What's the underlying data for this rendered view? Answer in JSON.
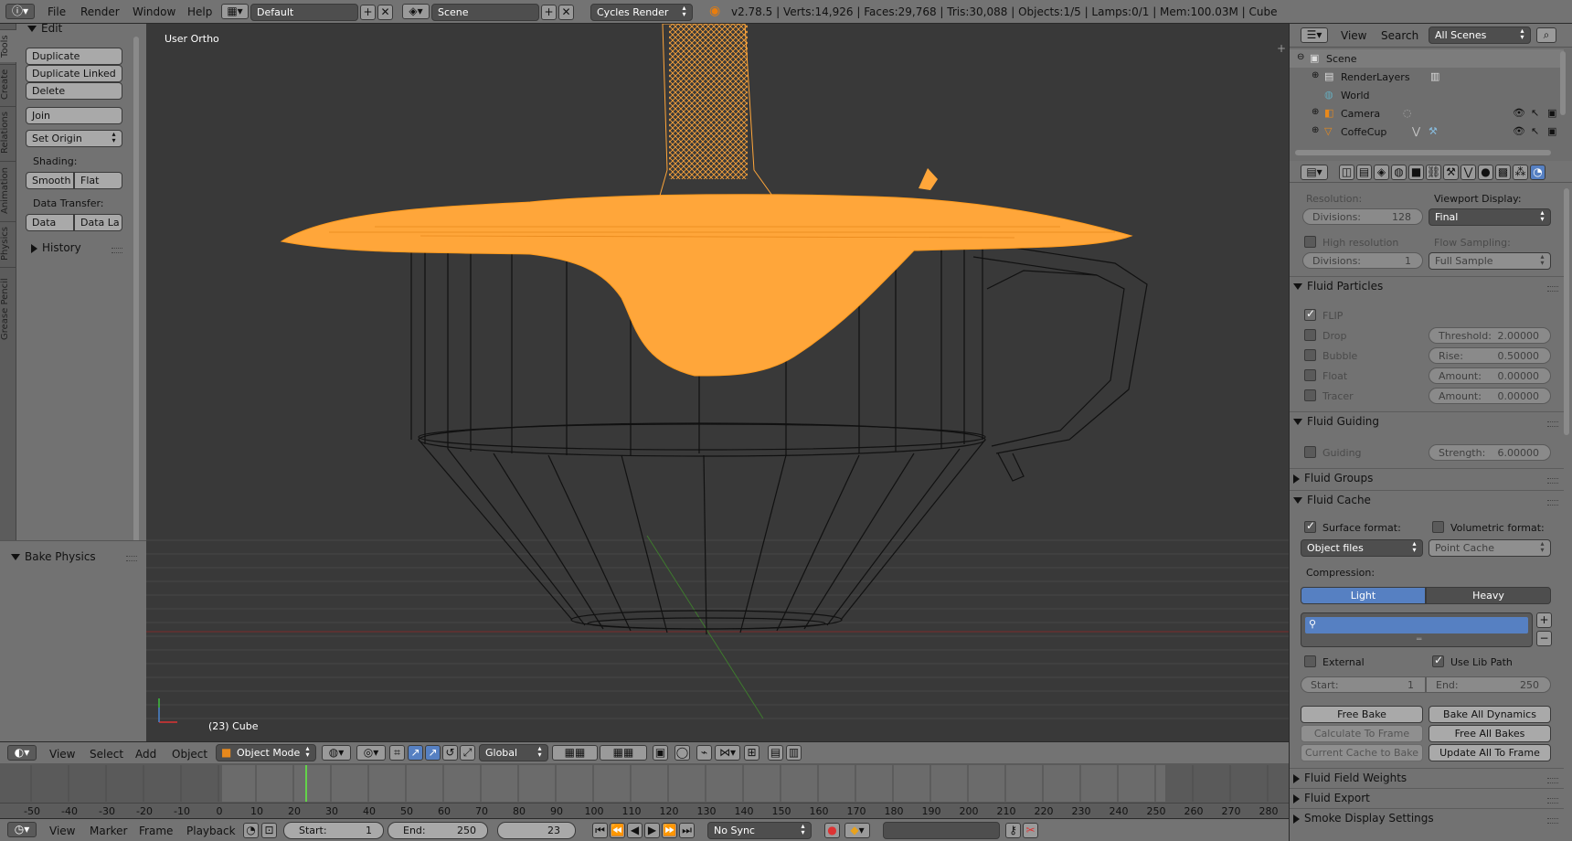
{
  "topbar": {
    "menus": [
      "File",
      "Render",
      "Window",
      "Help"
    ],
    "layout": "Default",
    "scene": "Scene",
    "engine": "Cycles Render",
    "stats": "v2.78.5 | Verts:14,926 | Faces:29,768 | Tris:30,088 | Objects:1/5 | Lamps:0/1 | Mem:100.03M | Cube"
  },
  "tools": {
    "tabs": [
      "Tools",
      "Create",
      "Relations",
      "Animation",
      "Physics",
      "Grease Pencil"
    ],
    "edit_header": "Edit",
    "duplicate": "Duplicate",
    "duplicate_linked": "Duplicate Linked",
    "delete": "Delete",
    "join": "Join",
    "set_origin": "Set Origin",
    "shading_label": "Shading:",
    "smooth": "Smooth",
    "flat": "Flat",
    "data_transfer_label": "Data Transfer:",
    "data": "Data",
    "data_layout": "Data La",
    "history": "History",
    "bake_physics": "Bake Physics"
  },
  "viewport": {
    "view_name": "User Ortho",
    "object_info": "(23) Cube",
    "header": {
      "view": "View",
      "select": "Select",
      "add": "Add",
      "object": "Object",
      "mode": "Object Mode",
      "orientation": "Global"
    }
  },
  "timeline": {
    "ticks": [
      "-50",
      "-40",
      "-30",
      "-20",
      "-10",
      "0",
      "10",
      "20",
      "30",
      "40",
      "50",
      "60",
      "70",
      "80",
      "90",
      "100",
      "110",
      "120",
      "130",
      "140",
      "150",
      "160",
      "170",
      "180",
      "190",
      "200",
      "210",
      "220",
      "230",
      "240",
      "250",
      "260",
      "270",
      "280"
    ],
    "current_frame": "23",
    "header": {
      "view": "View",
      "marker": "Marker",
      "frame": "Frame",
      "playback": "Playback",
      "start_label": "Start:",
      "start": "1",
      "end_label": "End:",
      "end": "250",
      "frame_value": "23",
      "sync": "No Sync"
    }
  },
  "outliner": {
    "view": "View",
    "search": "Search",
    "filter": "All Scenes",
    "items": [
      {
        "label": "Scene"
      },
      {
        "label": "RenderLayers"
      },
      {
        "label": "World"
      },
      {
        "label": "Camera"
      },
      {
        "label": "CoffeCup"
      }
    ]
  },
  "props": {
    "resolution_label": "Resolution:",
    "viewport_display_label": "Viewport Display:",
    "divisions_label": "Divisions:",
    "divisions": "128",
    "viewport_display": "Final",
    "high_resolution": "High resolution",
    "flow_sampling_label": "Flow Sampling:",
    "divisions2_label": "Divisions:",
    "divisions2": "1",
    "flow_sampling": "Full Sample",
    "fluid_particles": "Fluid Particles",
    "flip": "FLIP",
    "drop": "Drop",
    "bubble": "Bubble",
    "float": "Float",
    "tracer": "Tracer",
    "threshold_label": "Threshold:",
    "threshold": "2.00000",
    "rise_label": "Rise:",
    "rise": "0.50000",
    "amount_label": "Amount:",
    "amount1": "0.00000",
    "amount2": "0.00000",
    "fluid_guiding": "Fluid Guiding",
    "guiding": "Guiding",
    "strength_label": "Strength:",
    "strength": "6.00000",
    "fluid_groups": "Fluid Groups",
    "fluid_cache": "Fluid Cache",
    "surface_format": "Surface format:",
    "volumetric_format": "Volumetric format:",
    "surface_format_value": "Object files",
    "volumetric_format_value": "Point Cache",
    "compression_label": "Compression:",
    "light": "Light",
    "heavy": "Heavy",
    "external": "External",
    "use_lib_path": "Use Lib Path",
    "start_label": "Start:",
    "start": "1",
    "end_label": "End:",
    "end": "250",
    "free_bake": "Free Bake",
    "bake_all_dynamics": "Bake All Dynamics",
    "calculate_to_frame": "Calculate To Frame",
    "free_all_bakes": "Free All Bakes",
    "current_cache_to_bake": "Current Cache to Bake",
    "update_all_to_frame": "Update All To Frame",
    "fluid_field_weights": "Fluid Field Weights",
    "fluid_export": "Fluid Export",
    "smoke_display_settings": "Smoke Display Settings"
  },
  "colors": {
    "fluid": "#ffa63a",
    "accent_blue": "#5680c2",
    "playhead": "#63d34a"
  }
}
